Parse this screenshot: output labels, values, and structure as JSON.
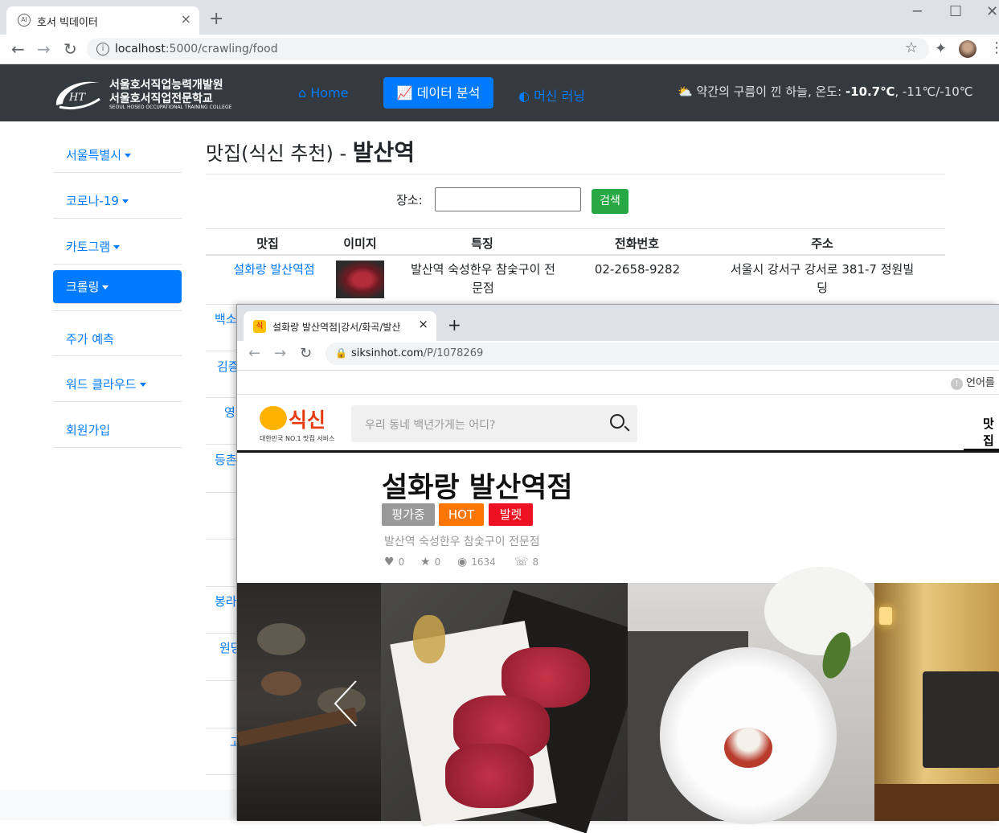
{
  "browser": {
    "tab_title": "호서 빅데이터",
    "url_host": "localhost",
    "url_rest": ":5000/crawling/food",
    "new_tab": "+",
    "close": "×",
    "win_min": "─",
    "win_max": "☐",
    "win_close": "✕"
  },
  "site": {
    "logo_line1": "서울호서직업능력개발원",
    "logo_line2": "서울호서직업전문학교",
    "logo_line3": "SEOUL HOSEO OCCUPATIONAL TRAINING COLLEGE",
    "nav": {
      "home": "Home",
      "data_analysis": "데이터 분석",
      "machine_learning": "머신 러닝"
    },
    "weather": {
      "desc": "약간의 구름이 낀 하늘, 온도:",
      "temp": "-10.7℃",
      "range": ", -11℃/-10℃"
    }
  },
  "sidebar": {
    "items": [
      {
        "label": "서울특별시",
        "dropdown": true
      },
      {
        "label": "코로나-19",
        "dropdown": true
      },
      {
        "label": "카토그램",
        "dropdown": true
      },
      {
        "label": "크롤링",
        "dropdown": true,
        "active": true
      },
      {
        "label": "주가 예측",
        "dropdown": false
      },
      {
        "label": "워드 클라우드",
        "dropdown": true
      },
      {
        "label": "회원가입",
        "dropdown": false
      }
    ]
  },
  "main": {
    "title_prefix": "맛집(식신 추천) -",
    "title_place": "발산역",
    "search_label": "장소:",
    "search_value": "",
    "search_button": "검색",
    "table": {
      "headers": [
        "맛집",
        "이미지",
        "특징",
        "전화번호",
        "주소"
      ],
      "rows": [
        {
          "name": "설화랑 발산역점",
          "feature_line1": "발산역 숙성한우 참숯구이 전",
          "feature_line2": "문점",
          "phone": "02-2658-9282",
          "address_line1": "서울시 강서구 강서로 381-7 정원빌",
          "address_line2": "딩"
        }
      ],
      "peek_names": [
        "백소",
        "김증",
        "영",
        "등촌",
        "봉라",
        "원당",
        "고"
      ]
    }
  },
  "popup": {
    "tab_title": "설화랑 발산역점|강서/화곡/발산",
    "url_host": "siksinhot.com",
    "url_rest": "/P/1078269",
    "language": "언어를",
    "logo_name": "식신",
    "logo_sub": "대한민국 NO.1 맛집 서비스",
    "search_placeholder": "우리 동네 백년가게는 어디?",
    "menu_first": "맛집",
    "restaurant_title": "설화랑 발산역점",
    "badges": [
      {
        "label": "평가중",
        "color": "#999999"
      },
      {
        "label": "HOT",
        "color": "#ff7700"
      },
      {
        "label": "발렛",
        "color": "#ee1122"
      }
    ],
    "description": "발산역 숙성한우 참숯구이 전문점",
    "stats": {
      "likes": "0",
      "stars": "0",
      "views": "1634",
      "calls": "8"
    }
  }
}
